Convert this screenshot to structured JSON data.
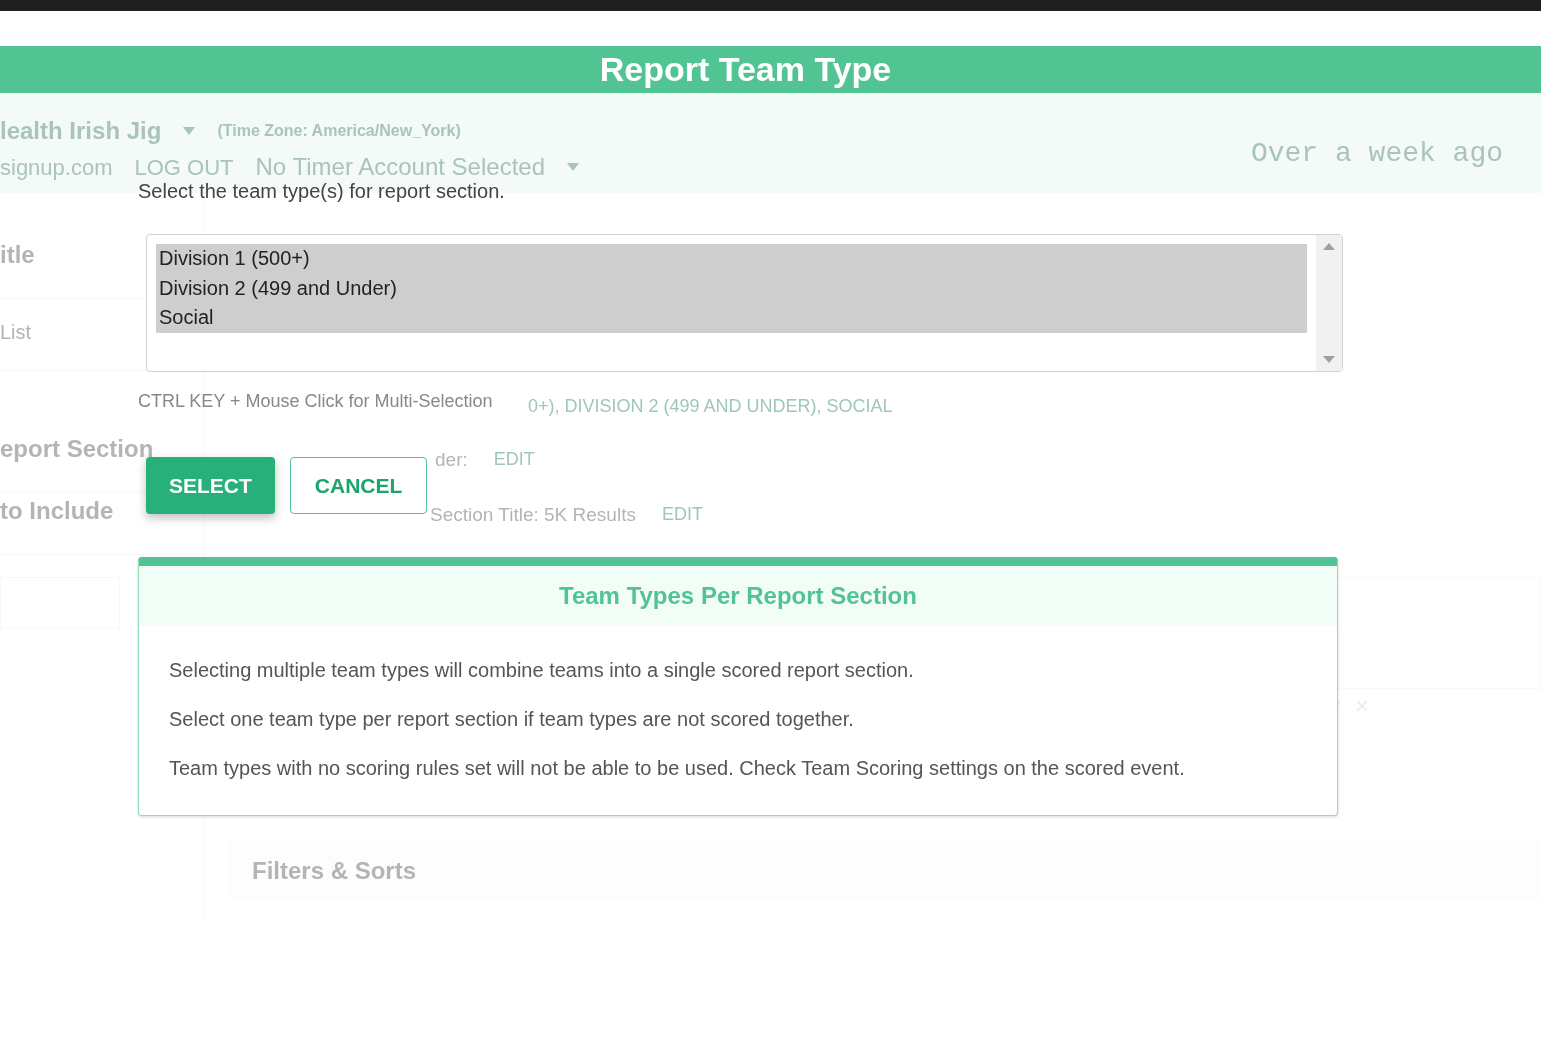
{
  "background": {
    "header": {
      "event_name": "lealth Irish Jig",
      "time_zone": "(Time Zone: America/New_York)",
      "account": "signup.com",
      "logout": "LOG OUT",
      "timer_account": "No Timer Account Selected",
      "updated": "Over a week ago"
    },
    "sidebar": [
      {
        "label": "itle",
        "kind": "heading"
      },
      {
        "label": "List",
        "kind": "link"
      },
      {
        "label": "eport Section",
        "kind": "heading"
      },
      {
        "label": "to Include",
        "kind": "heading"
      }
    ],
    "main": {
      "team_types": "0+), DIVISION 2 (499 AND UNDER), SOCIAL",
      "section_header": "der:",
      "section_header_action": "EDIT",
      "section_title": "Section Title: 5K Results",
      "section_title_action": "EDIT",
      "filters_heading": "Filters & Sorts"
    }
  },
  "dialog": {
    "title": "Report Team Type",
    "prompt": "Select the team type(s) for report section.",
    "options": [
      {
        "label": "Division 1 (500+)",
        "selected": true
      },
      {
        "label": "Division 2 (499 and Under)",
        "selected": true
      },
      {
        "label": "Social",
        "selected": true
      }
    ],
    "hint": "CTRL KEY + Mouse Click for Multi-Selection",
    "buttons": [
      {
        "label": "SELECT",
        "kind": "primary"
      },
      {
        "label": "CANCEL",
        "kind": "secondary"
      }
    ],
    "info": {
      "title": "Team Types Per Report Section",
      "paragraphs": [
        "Selecting multiple team types will combine teams into a single scored report section.",
        "Select one team type per report section if team types are not scored together.",
        "Team types with no scoring rules set will not be able to be used. Check Team Scoring settings on the scored event."
      ]
    }
  }
}
